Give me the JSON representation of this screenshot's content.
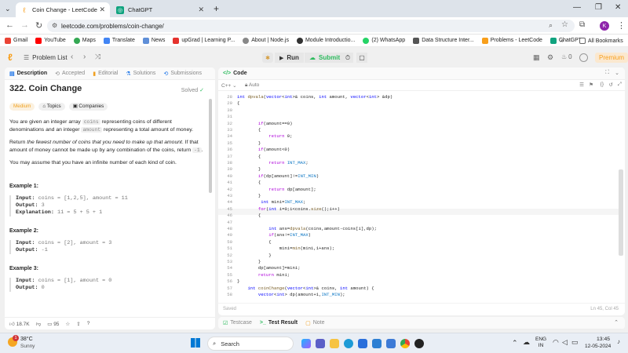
{
  "browser": {
    "tabs": [
      {
        "title": "Coin Change - LeetCode",
        "active": true
      },
      {
        "title": "ChatGPT",
        "active": false
      }
    ],
    "url": "leetcode.com/problems/coin-change/",
    "profile_initial": "K",
    "bookmarks": [
      "Gmail",
      "YouTube",
      "Maps",
      "Translate",
      "News",
      "upGrad | Learning P...",
      "About | Node.js",
      "Module Introductio...",
      "(2) WhatsApp",
      "Data Structure Inter...",
      "Problems - LeetCode",
      "ChatGPT"
    ],
    "all_bookmarks": "All Bookmarks"
  },
  "lcnav": {
    "problem_list": "Problem List",
    "run": "Run",
    "submit": "Submit",
    "zero": "0",
    "premium": "Premium"
  },
  "left_tabs": [
    "Description",
    "Accepted",
    "Editorial",
    "Solutions",
    "Submissions"
  ],
  "problem": {
    "title": "322. Coin Change",
    "status": "Solved",
    "difficulty": "Medium",
    "topics": "Topics",
    "companies": "Companies",
    "p1a": "You are given an integer array ",
    "p1b": "coins",
    "p1c": " representing coins of different denominations and an integer ",
    "p1d": "amount",
    "p1e": " representing a total amount of money.",
    "p2a": "Return ",
    "p2b": "the fewest number of coins that you need to make up that amount",
    "p2c": ". If that amount of money cannot be made up by any combination of the coins, return ",
    "p2d": "-1",
    "p2e": ".",
    "p3": "You may assume that you have an infinite number of each kind of coin.",
    "examples": [
      {
        "label": "Example 1:",
        "input_k": "Input:",
        "input": "coins = [1,2,5], amount = 11",
        "output_k": "Output:",
        "output": "3",
        "expl_k": "Explanation:",
        "expl": "11 = 5 + 5 + 1"
      },
      {
        "label": "Example 2:",
        "input_k": "Input:",
        "input": "coins = [2], amount = 3",
        "output_k": "Output:",
        "output": "-1"
      },
      {
        "label": "Example 3:",
        "input_k": "Input:",
        "input": "coins = [1], amount = 0",
        "output_k": "Output:",
        "output": "0"
      }
    ],
    "likes": "18.7K",
    "comments": "95"
  },
  "code": {
    "title": "Code",
    "lang": "C++",
    "auto": "Auto",
    "saved": "Saved",
    "cursor": "Ln 45, Col 45",
    "lines": [
      {
        "n": "28",
        "t": "int dpvala(vector<int>& coins, int amount, vector<int> &dp)"
      },
      {
        "n": "29",
        "t": "{"
      },
      {
        "n": "30",
        "t": ""
      },
      {
        "n": "31",
        "t": ""
      },
      {
        "n": "32",
        "t": "        if(amount==0)"
      },
      {
        "n": "33",
        "t": "        {"
      },
      {
        "n": "34",
        "t": "            return 0;"
      },
      {
        "n": "35",
        "t": "        }"
      },
      {
        "n": "36",
        "t": "        if(amount<0)"
      },
      {
        "n": "37",
        "t": "        {"
      },
      {
        "n": "38",
        "t": "            return INT_MAX;"
      },
      {
        "n": "39",
        "t": "        }"
      },
      {
        "n": "40",
        "t": "        if(dp[amount]!=INT_MIN)"
      },
      {
        "n": "41",
        "t": "        {"
      },
      {
        "n": "42",
        "t": "            return dp[amount];"
      },
      {
        "n": "43",
        "t": "        }"
      },
      {
        "n": "44",
        "t": "         int mini=INT_MAX;"
      },
      {
        "n": "45",
        "t": "        for(int i=0;i<coins.size();i++)"
      },
      {
        "n": "46",
        "t": "        {"
      },
      {
        "n": "47",
        "t": ""
      },
      {
        "n": "48",
        "t": "            int ans=dpvala(coins,amount-coins[i],dp);"
      },
      {
        "n": "49",
        "t": "            if(ans!=INT_MAX)"
      },
      {
        "n": "50",
        "t": "            {"
      },
      {
        "n": "51",
        "t": "                mini=min(mini,1+ans);"
      },
      {
        "n": "52",
        "t": "            }"
      },
      {
        "n": "53",
        "t": "        }"
      },
      {
        "n": "54",
        "t": "        dp[amount]=mini;"
      },
      {
        "n": "55",
        "t": "        return mini;"
      },
      {
        "n": "56",
        "t": "}"
      },
      {
        "n": "57",
        "t": "    int coinChange(vector<int>& coins, int amount) {"
      },
      {
        "n": "58",
        "t": "        vector<int> dp(amount+1,INT_MIN);"
      }
    ]
  },
  "bottom_tabs": [
    "Testcase",
    "Test Result",
    "Note"
  ],
  "taskbar": {
    "temp": "38°C",
    "weather": "Sunny",
    "search": "Search",
    "lang1": "ENG",
    "lang2": "IN",
    "time": "13:45",
    "date": "12-05-2024",
    "badge": "1"
  }
}
